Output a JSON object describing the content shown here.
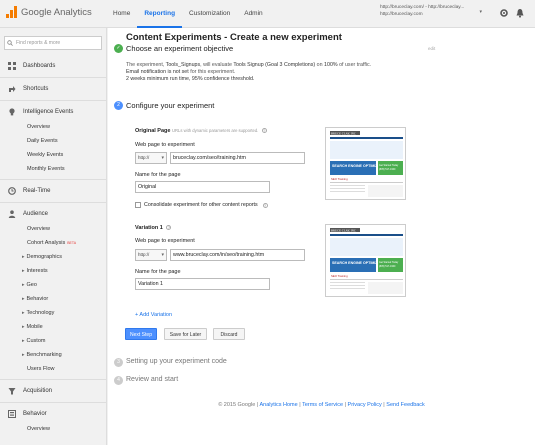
{
  "header": {
    "app_name": "Google Analytics",
    "nav": [
      "Home",
      "Reporting",
      "Customization",
      "Admin"
    ],
    "active_nav": "Reporting",
    "account_lines": [
      "http://bruceclay.com/ - http://bruceclay...",
      "http://bruceclay.com"
    ]
  },
  "sidebar": {
    "search_placeholder": "Find reports & more",
    "sections": {
      "dashboards": "Dashboards",
      "shortcuts": "Shortcuts",
      "intelligence": "Intelligence Events",
      "realtime": "Real-Time",
      "audience": "Audience",
      "acquisition": "Acquisition",
      "behavior": "Behavior"
    },
    "intelligence_items": [
      "Overview",
      "Daily Events",
      "Weekly Events",
      "Monthly Events"
    ],
    "audience_items": [
      "Overview",
      "Cohort Analysis",
      "Demographics",
      "Interests",
      "Geo",
      "Behavior",
      "Technology",
      "Mobile",
      "Custom",
      "Benchmarking",
      "Users Flow"
    ],
    "cohort_badge": "BETA",
    "behavior_items": [
      "Overview"
    ]
  },
  "main": {
    "title": "Content Experiments - Create a new experiment",
    "step1": {
      "number": "1",
      "title": "Choose an experiment objective",
      "edit": "edit",
      "p1_a": "The experiment,",
      "p1_name": "Tools_Signups",
      "p1_b": ", will evaluate",
      "p1_goal": "Tools Signup (Goal 3 Completions)",
      "p1_c": "on",
      "p1_pct": "100%",
      "p1_d": "of user traffic.",
      "p2_a": "Email notification is",
      "p2_b": "not set",
      "p2_c": "for this experiment.",
      "p3": "2 weeks minimum run time, 95% confidence threshold."
    },
    "step2": {
      "number": "2",
      "title": "Configure your experiment",
      "original": {
        "heading": "Original Page",
        "hint": "URLs with dynamic parameters are supported.",
        "url_label": "Web page to experiment",
        "protocol": "http://",
        "url": "bruceclay.com/seo/training.htm",
        "name_label": "Name for the page",
        "name": "Original",
        "consolidate": "Consolidate experiment for other content reports"
      },
      "variation": {
        "heading": "Variation 1",
        "url_label": "Web page to experiment",
        "protocol": "http://",
        "url": "www.bruceclay.com/in/seo/training.htm",
        "name_label": "Name for the page",
        "name": "Variation 1"
      },
      "add_variation": "+ Add Variation",
      "next": "Next Step",
      "save": "Save for Later",
      "discard": "Discard"
    },
    "step3": {
      "number": "3",
      "title": "Setting up your experiment code"
    },
    "step4": {
      "number": "4",
      "title": "Review and start"
    },
    "footer": {
      "copyright": "© 2015 Google",
      "links": [
        "Analytics Home",
        "Terms of Service",
        "Privacy Policy",
        "Send Feedback"
      ]
    }
  },
  "thumbnail": {
    "brand": "BRUCE CLAY, INC",
    "headline": "SEARCH ENGINE OPTIMIZATION",
    "cta": "Get Started Today",
    "phone": "(805) 517-1900",
    "caption": "SEO Training"
  },
  "colors": {
    "accent": "#1a73e8",
    "success": "#4caf50",
    "brand": "#f57c00"
  }
}
